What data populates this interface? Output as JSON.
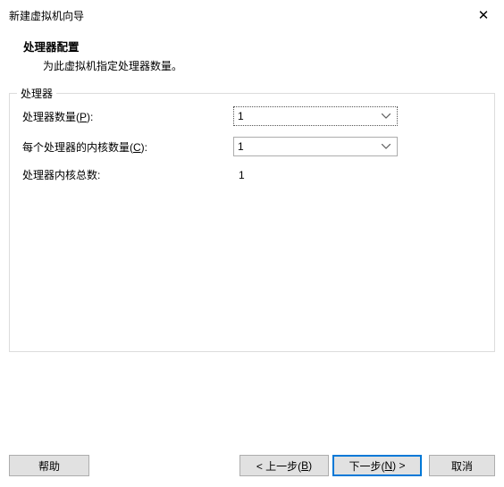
{
  "window": {
    "title": "新建虚拟机向导",
    "close": "✕"
  },
  "header": {
    "title": "处理器配置",
    "description": "为此虚拟机指定处理器数量。"
  },
  "group": {
    "legend": "处理器",
    "rows": {
      "processors": {
        "label_pre": "处理器数量(",
        "mnemonic": "P",
        "label_post": "):",
        "value": "1"
      },
      "cores": {
        "label_pre": "每个处理器的内核数量(",
        "mnemonic": "C",
        "label_post": "):",
        "value": "1"
      },
      "total": {
        "label": "处理器内核总数:",
        "value": "1"
      }
    }
  },
  "buttons": {
    "help": "帮助",
    "back_pre": "< 上一步(",
    "back_m": "B",
    "back_post": ")",
    "next_pre": "下一步(",
    "next_m": "N",
    "next_post": ") >",
    "cancel": "取消"
  }
}
